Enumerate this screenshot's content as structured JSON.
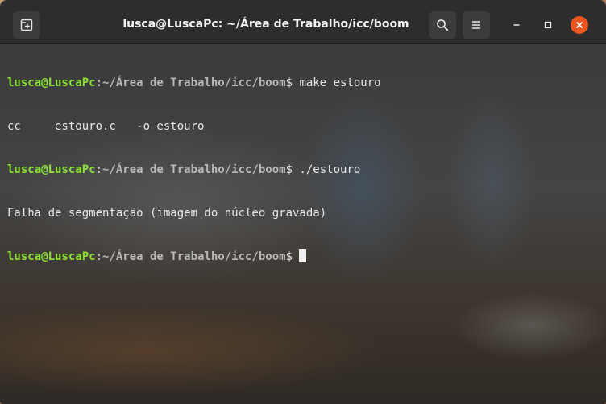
{
  "window": {
    "title": "lusca@LuscaPc: ~/Área de Trabalho/icc/boom"
  },
  "titlebar": {
    "new_tab_icon": "new-tab-icon",
    "search_icon": "search-icon",
    "menu_icon": "hamburger-menu-icon",
    "minimize_icon": "minimize-icon",
    "maximize_icon": "maximize-icon",
    "close_icon": "close-icon",
    "close_color": "#e95420"
  },
  "terminal": {
    "prompt_user": "lusca@LuscaPc",
    "prompt_path": ":~/Área de Trabalho/icc/boom",
    "prompt_symbol": "$ ",
    "user_color": "#8ae234",
    "lines": [
      {
        "type": "prompt",
        "command": "make estouro"
      },
      {
        "type": "output",
        "text": "cc     estouro.c   -o estouro"
      },
      {
        "type": "prompt",
        "command": "./estouro"
      },
      {
        "type": "output",
        "text": "Falha de segmentação (imagem do núcleo gravada)"
      },
      {
        "type": "prompt",
        "command": ""
      }
    ]
  }
}
